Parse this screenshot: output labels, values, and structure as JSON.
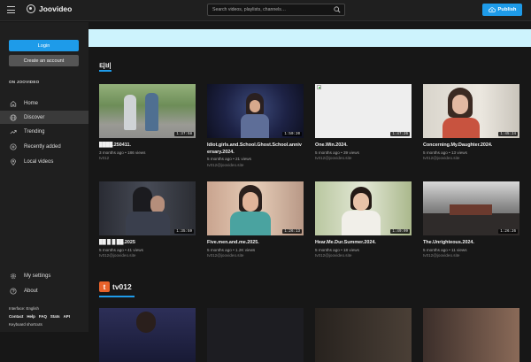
{
  "header": {
    "site_name": "Joovideo",
    "search_placeholder": "Search videos, playlists, channels…",
    "publish_label": "Publish"
  },
  "sidebar": {
    "login_label": "Login",
    "create_account_label": "Create an account",
    "section_heading": "ON JOOVIDEO",
    "nav": [
      {
        "label": "Home",
        "icon": "home-icon"
      },
      {
        "label": "Discover",
        "icon": "globe-icon",
        "active": true
      },
      {
        "label": "Trending",
        "icon": "trending-icon"
      },
      {
        "label": "Recently added",
        "icon": "plus-circle-icon"
      },
      {
        "label": "Local videos",
        "icon": "location-pin-icon"
      }
    ],
    "bottom_nav": [
      {
        "label": "My settings",
        "icon": "gear-icon"
      },
      {
        "label": "About",
        "icon": "question-icon"
      }
    ],
    "footer": {
      "interface": "Interface: English",
      "links": [
        "Contact",
        "Help",
        "FAQ",
        "Stats",
        "API"
      ],
      "shortcuts": "Keyboard shortcuts"
    }
  },
  "sections": {
    "first_title": "티비",
    "channel_badge": "t",
    "channel_name": "tv012"
  },
  "videos": [
    {
      "title": "████.250411.",
      "duration": "1:37:58",
      "meta": "3 months ago • 186 views",
      "channel": "tv012"
    },
    {
      "title": "Idiot.girls.and.School.Ghost.School.anniversary.2024.",
      "duration": "1:50:20",
      "meta": "5 months ago • 21 views",
      "channel": "tv012@joovideo.site"
    },
    {
      "title": "One.Win.2024.",
      "duration": "1:47:26",
      "meta": "5 months ago • 39 views",
      "channel": "tv012@joovideo.site"
    },
    {
      "title": "Concerning.My.Daughter.2024.",
      "duration": "1:45:24",
      "meta": "5 months ago • 13 views",
      "channel": "tv012@joovideo.site"
    },
    {
      "title": "██ █ █ ██.2025",
      "duration": "1:35:59",
      "meta": "5 months ago • 41 views",
      "channel": "tv012@joovideo.site"
    },
    {
      "title": "Five.men.and.me.2025.",
      "duration": "1:26:13",
      "meta": "5 months ago • 1.2K views",
      "channel": "tv012@joovideo.site"
    },
    {
      "title": "Hear.Me.Dur.Summer.2024.",
      "duration": "1:49:09",
      "meta": "5 months ago • 18 views",
      "channel": "tv012@joovideo.site"
    },
    {
      "title": "The.Unrighteous.2024.",
      "duration": "1:26:26",
      "meta": "5 months ago • 11 views",
      "channel": "tv012@joovideo.site"
    }
  ]
}
